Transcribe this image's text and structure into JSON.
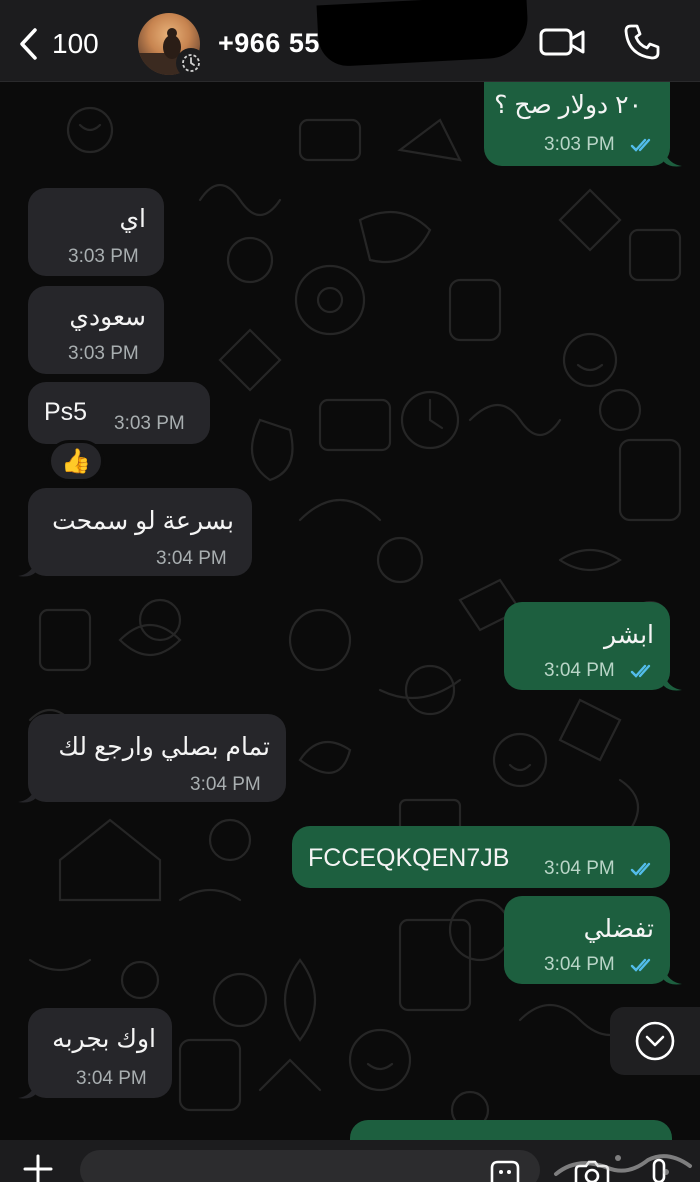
{
  "header": {
    "back_count": "100",
    "contact_name": "+966 55"
  },
  "messages": [
    {
      "id": "m1",
      "dir": "out",
      "text": "٢٠ دولار صح ؟",
      "time": "3:03 PM",
      "read": true
    },
    {
      "id": "m2",
      "dir": "in",
      "text": "اي",
      "time": "3:03 PM"
    },
    {
      "id": "m3",
      "dir": "in",
      "text": "سعودي",
      "time": "3:03 PM"
    },
    {
      "id": "m4",
      "dir": "in",
      "text": "Ps5",
      "time": "3:03 PM",
      "reaction": "👍"
    },
    {
      "id": "m5",
      "dir": "in",
      "text": "بسرعة لو سمحت",
      "time": "3:04 PM"
    },
    {
      "id": "m6",
      "dir": "out",
      "text": "ابشر",
      "time": "3:04 PM",
      "read": true
    },
    {
      "id": "m7",
      "dir": "in",
      "text": "تمام بصلي وارجع لك",
      "time": "3:04 PM"
    },
    {
      "id": "m8",
      "dir": "out",
      "text": "FCCEQKQEN7JB",
      "time": "3:04 PM",
      "read": true
    },
    {
      "id": "m9",
      "dir": "out",
      "text": "تفضلي",
      "time": "3:04 PM",
      "read": true
    },
    {
      "id": "m10",
      "dir": "in",
      "text": "اوك بجربه",
      "time": "3:04 PM"
    }
  ],
  "icons": {
    "back": "chevron-left-icon",
    "video": "video-call-icon",
    "call": "phone-icon",
    "scroll": "chevron-down-circle-icon",
    "plus": "plus-icon",
    "sticker": "sticker-icon",
    "camera": "camera-icon",
    "mic": "microphone-icon"
  },
  "colors": {
    "incoming_bubble": "#26262a",
    "outgoing_bubble": "#1d5f3f",
    "read_ticks": "#53bdeb",
    "background": "#0b0b0b"
  }
}
